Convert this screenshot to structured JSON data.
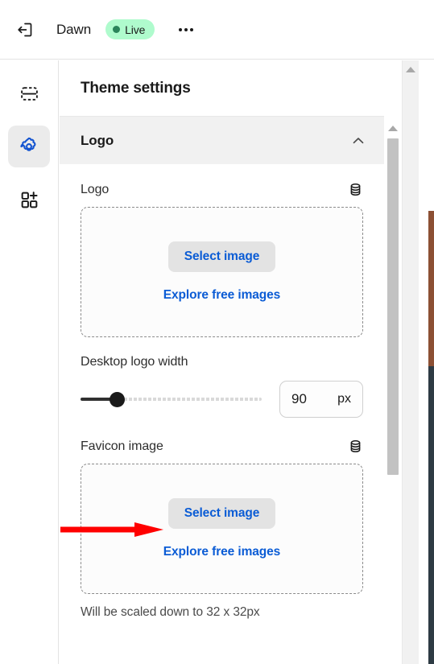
{
  "topbar": {
    "exit_icon": "exit-icon",
    "store_name": "Dawn",
    "status_badge": "Live",
    "status_color": "#2a845a",
    "status_bg": "#affbcd",
    "more_menu_icon": "ellipsis-icon"
  },
  "rail": {
    "items": [
      {
        "icon": "sections-icon",
        "name": "sections",
        "active": false
      },
      {
        "icon": "gear-icon",
        "name": "theme-settings",
        "active": true
      },
      {
        "icon": "apps-add-icon",
        "name": "apps",
        "active": false
      }
    ],
    "active_color": "#1353d0"
  },
  "panel": {
    "title": "Theme settings",
    "section": {
      "title": "Logo",
      "collapse_icon": "chevron-up-icon",
      "collapsed": false
    },
    "fields": [
      {
        "label": "Logo",
        "metafield_icon": "database-icon",
        "select_button": "Select image",
        "explore_link": "Explore free images",
        "help_text": ""
      },
      {
        "label": "Desktop logo width",
        "value": "90",
        "unit": "px",
        "slider_percent": 21
      },
      {
        "label": "Favicon image",
        "metafield_icon": "database-icon",
        "select_button": "Select image",
        "explore_link": "Explore free images",
        "help_text": "Will be scaled down to 32 x 32px"
      }
    ],
    "link_color": "#0b5cd5",
    "button_bg": "#e3e3e3"
  },
  "annotation": {
    "arrow_color": "#ff0000",
    "points_to": "favicon-select-image-button"
  },
  "scrollbars": {
    "inner_thumb_color": "#c2c2c2",
    "arrow_icon": "caret-up-icon"
  }
}
